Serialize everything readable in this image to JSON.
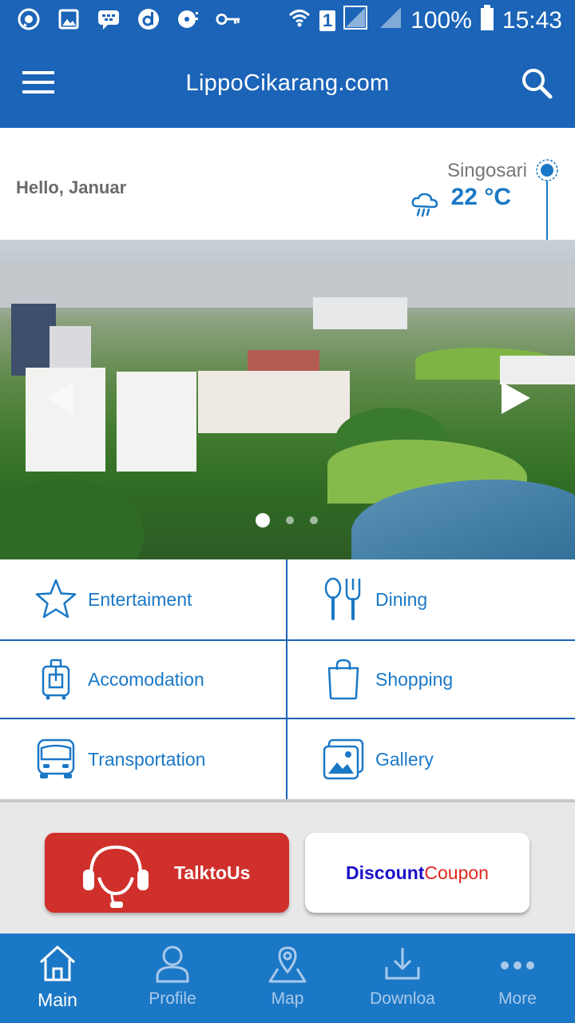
{
  "status_bar": {
    "battery": "100%",
    "time": "15:43",
    "sim": "1",
    "icons": [
      "whatsapp-icon",
      "gallery-icon",
      "bbm-icon",
      "dailymotion-icon",
      "media-icon",
      "key-icon"
    ]
  },
  "app_bar": {
    "title": "LippoCikarang.com"
  },
  "greeting": {
    "hello": "Hello, Januar",
    "city": "Singosari",
    "temperature": "22 °C"
  },
  "carousel": {
    "slides": 3,
    "active": 0
  },
  "categories": [
    {
      "label": "Entertaiment",
      "icon": "star-icon"
    },
    {
      "label": "Dining",
      "icon": "dining-icon"
    },
    {
      "label": "Accomodation",
      "icon": "luggage-icon"
    },
    {
      "label": "Shopping",
      "icon": "shopping-bag-icon"
    },
    {
      "label": "Transportation",
      "icon": "bus-icon"
    },
    {
      "label": "Gallery",
      "icon": "gallery-icon"
    }
  ],
  "actions": {
    "talk": "TalktoUs",
    "coupon_blue": "Discount",
    "coupon_red": "Coupon"
  },
  "bottom_nav": [
    {
      "label": "Main",
      "icon": "home-icon",
      "active": true
    },
    {
      "label": "Profile",
      "icon": "profile-icon"
    },
    {
      "label": "Map",
      "icon": "map-icon"
    },
    {
      "label": "Downloa",
      "icon": "download-icon"
    },
    {
      "label": "More",
      "icon": "more-icon"
    }
  ],
  "colors": {
    "primary": "#1b64b8",
    "accent": "#1b78c6",
    "talk_red": "#d0302b",
    "coupon_blue": "#1a10c8",
    "coupon_red": "#e0281e"
  }
}
